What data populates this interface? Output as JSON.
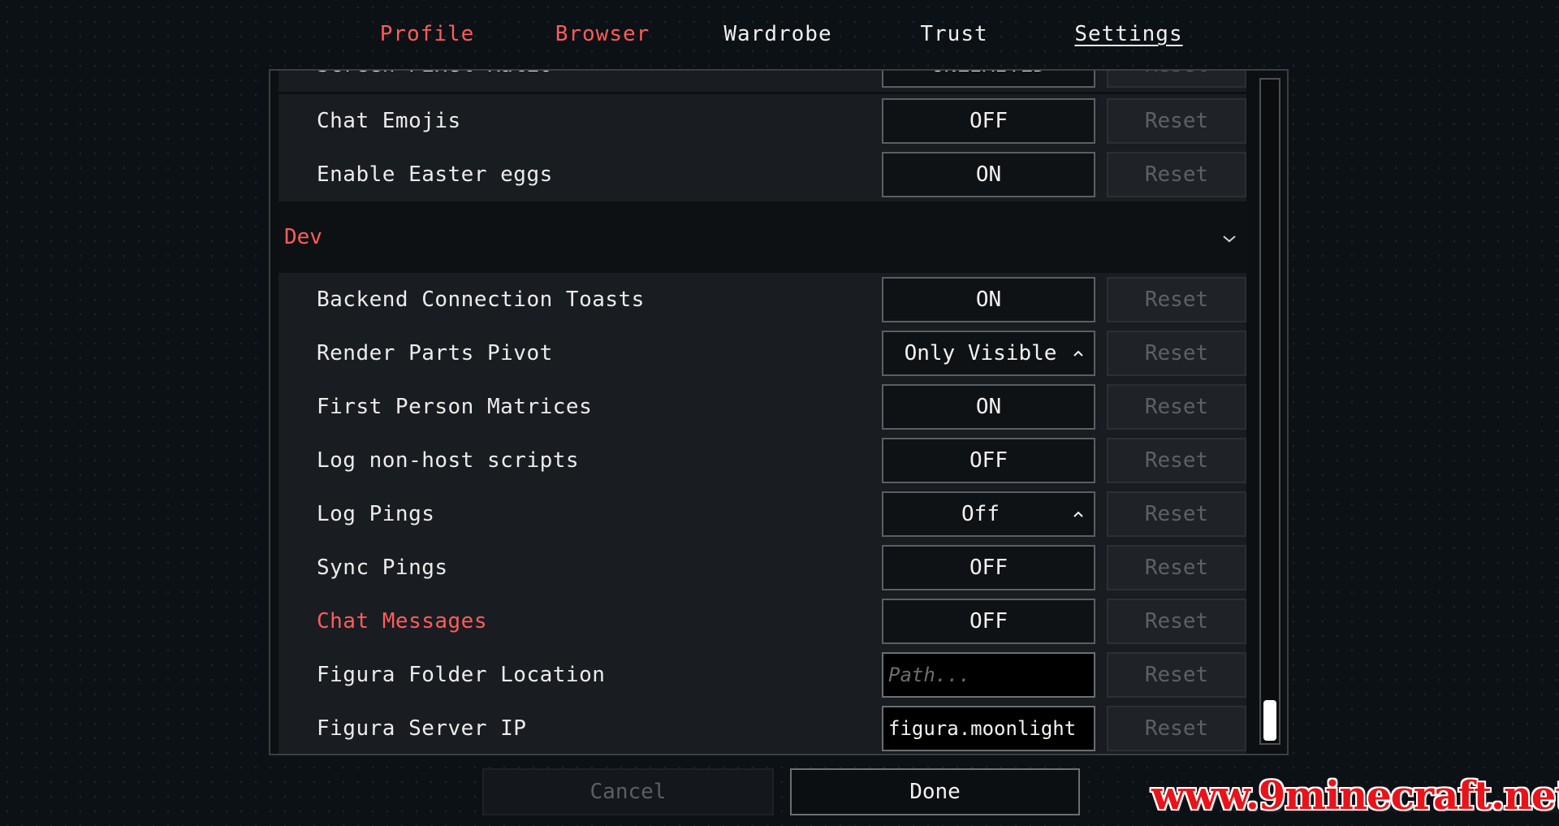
{
  "tabs": [
    {
      "label": "Profile"
    },
    {
      "label": "Browser"
    },
    {
      "label": "Wardrobe"
    },
    {
      "label": "Trust"
    },
    {
      "label": "Settings"
    }
  ],
  "active_tab": "Settings",
  "partial_row": {
    "label": "Screen Pixel Ratio",
    "value": "UNLIMITED",
    "reset": "Reset"
  },
  "rows_top": [
    {
      "label": "Chat Emojis",
      "value": "OFF",
      "reset": "Reset"
    },
    {
      "label": "Enable Easter eggs",
      "value": "ON",
      "reset": "Reset"
    }
  ],
  "dev_category": {
    "label": "Dev",
    "chevron_icon": "chevron-down-icon"
  },
  "rows_dev": [
    {
      "label": "Backend Connection Toasts",
      "value": "ON",
      "reset": "Reset"
    },
    {
      "label": "Render Parts Pivot",
      "value": "Only Visible",
      "reset": "Reset",
      "type": "dropdown"
    },
    {
      "label": "First Person Matrices",
      "value": "ON",
      "reset": "Reset"
    },
    {
      "label": "Log non-host scripts",
      "value": "OFF",
      "reset": "Reset"
    },
    {
      "label": "Log Pings",
      "value": "Off",
      "reset": "Reset",
      "type": "dropdown"
    },
    {
      "label": "Sync Pings",
      "value": "OFF",
      "reset": "Reset"
    },
    {
      "label": "Chat Messages",
      "value": "OFF",
      "reset": "Reset",
      "highlight": true
    },
    {
      "label": "Figura Folder Location",
      "placeholder": "Path...",
      "value": "",
      "reset": "Reset",
      "type": "input"
    },
    {
      "label": "Figura Server IP",
      "value": "figura.moonlight",
      "reset": "Reset",
      "type": "input"
    }
  ],
  "buttons": {
    "cancel": "Cancel",
    "done": "Done"
  },
  "watermark": "www.9minecraft.net",
  "colors": {
    "accent_red": "#ff5c5c",
    "background": "#0c1116",
    "row": "#191d22"
  }
}
